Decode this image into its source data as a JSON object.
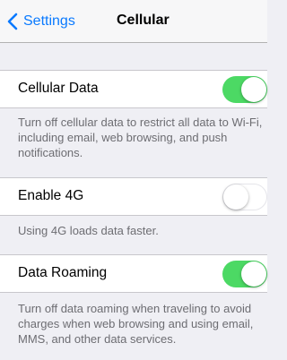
{
  "navbar": {
    "back_label": "Settings",
    "back_icon": "chevron-left-icon",
    "title": "Cellular",
    "accent_color": "#0a7aff"
  },
  "rows": [
    {
      "label": "Cellular Data",
      "enabled": true,
      "footnote": "Turn off cellular data to restrict all data to Wi-Fi, including email, web browsing, and push notifications."
    },
    {
      "label": "Enable 4G",
      "enabled": false,
      "footnote": "Using 4G loads data faster."
    },
    {
      "label": "Data Roaming",
      "enabled": true,
      "footnote": "Turn off data roaming when traveling to avoid charges when web browsing and using email, MMS, and other data services."
    }
  ],
  "colors": {
    "switch_on": "#4cd964",
    "background": "#efeff4",
    "footnote_text": "#6d6d72"
  }
}
